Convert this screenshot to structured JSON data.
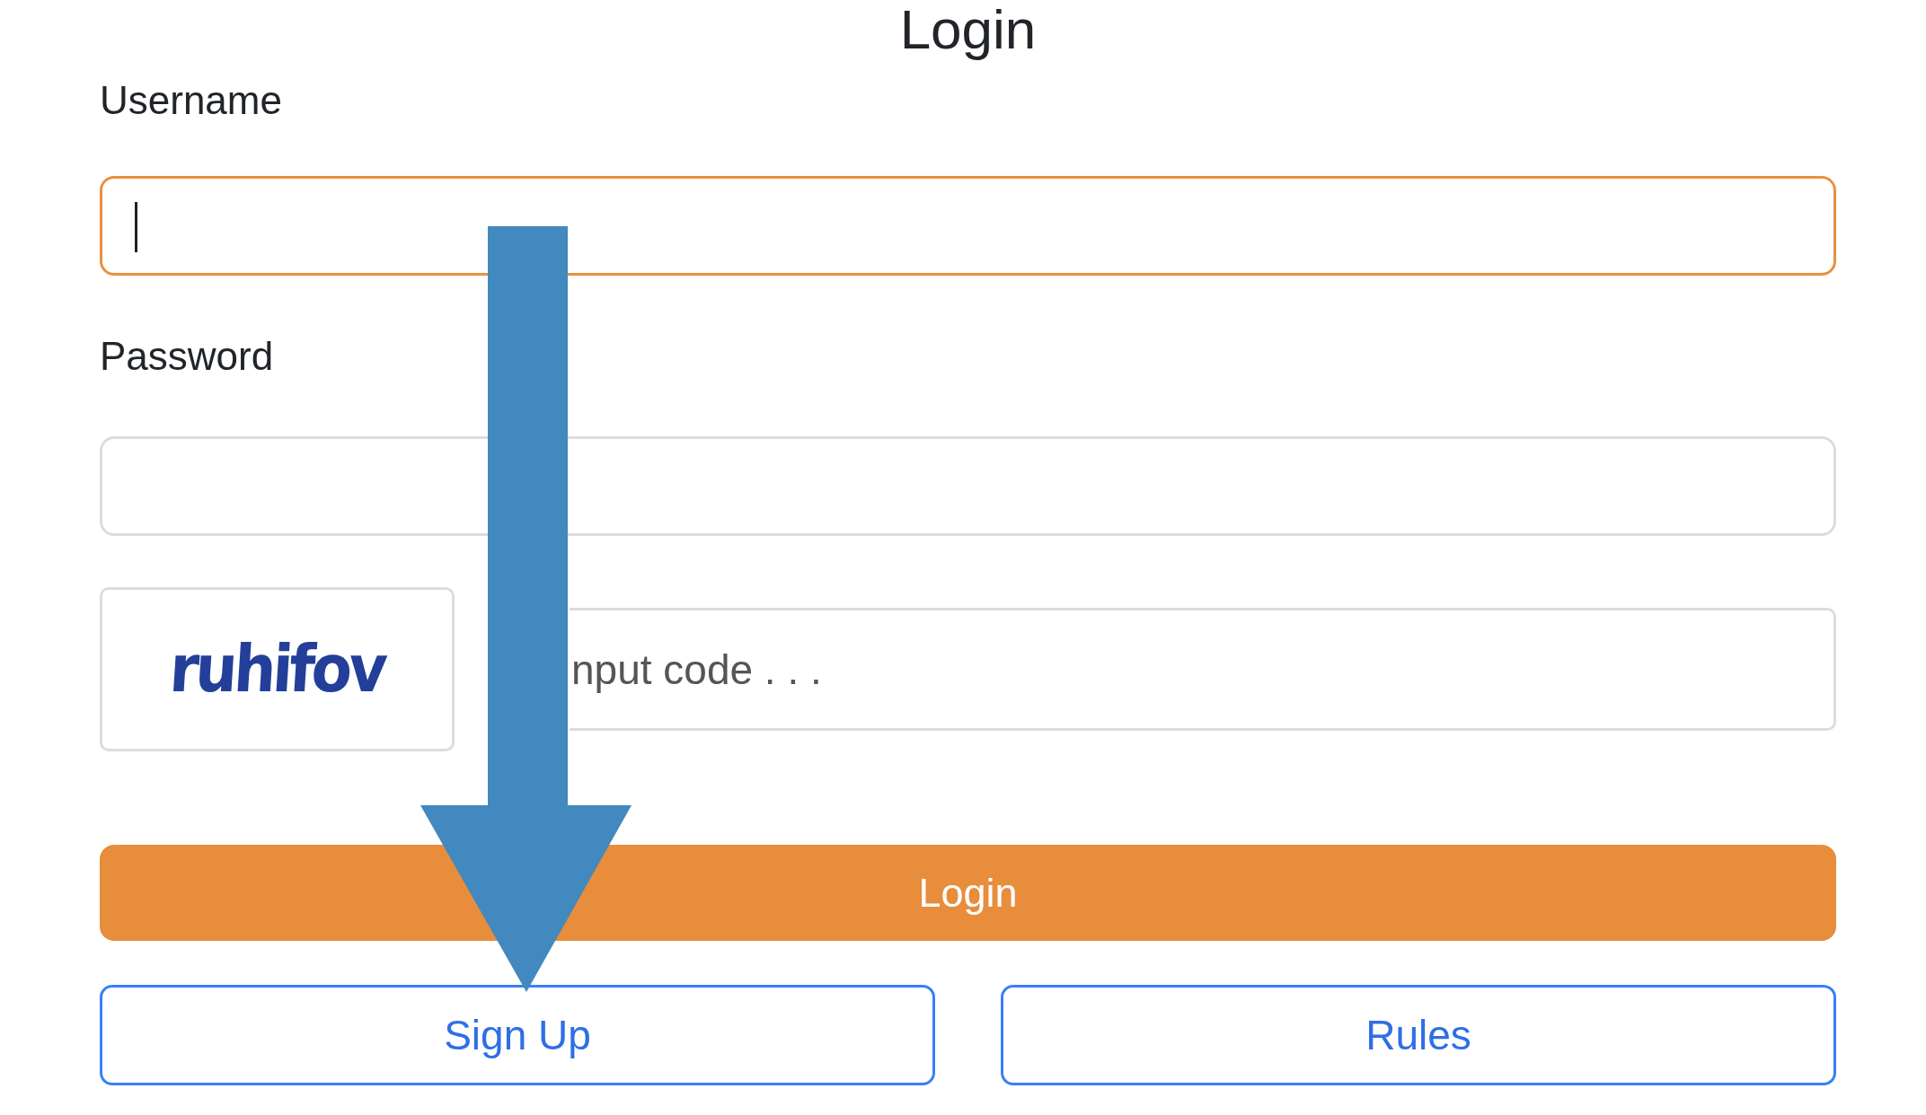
{
  "title": "Login",
  "fields": [
    {
      "label": "Username",
      "focused": true
    },
    {
      "label": "Password",
      "focused": false
    }
  ],
  "captcha": {
    "code": "ruhifov",
    "placeholder": "nput code . . ."
  },
  "login_button": "Login",
  "buttons": [
    "Sign Up",
    "Rules"
  ]
}
